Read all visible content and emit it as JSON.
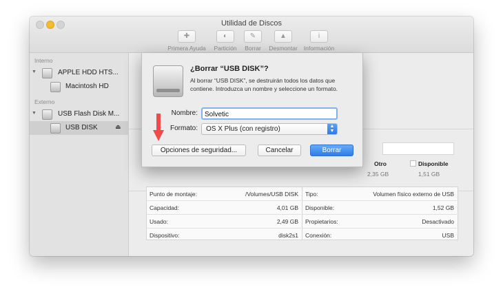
{
  "window": {
    "title": "Utilidad de Discos",
    "toolbar": [
      {
        "label": "Primera Ayuda",
        "icon": "first-aid-icon"
      },
      {
        "label": "Partición",
        "icon": "partition-icon"
      },
      {
        "label": "Borrar",
        "icon": "erase-icon"
      },
      {
        "label": "Desmontar",
        "icon": "unmount-icon"
      },
      {
        "label": "Información",
        "icon": "info-icon"
      }
    ]
  },
  "sidebar": {
    "internal_header": "Interno",
    "external_header": "Externo",
    "items": [
      {
        "label": "APPLE HDD HTS..."
      },
      {
        "label": "Macintosh HD"
      },
      {
        "label": "USB Flash Disk M..."
      },
      {
        "label": "USB DISK",
        "eject": "⏏"
      }
    ]
  },
  "usage": {
    "other_label": "Otro",
    "other_value": "2,35 GB",
    "other_color": "#ffffff",
    "available_label": "Disponible",
    "available_value": "1,51 GB",
    "available_color": "#ffffff"
  },
  "info": {
    "left": [
      {
        "key": "Punto de montaje:",
        "value": "/Volumes/USB DISK"
      },
      {
        "key": "Capacidad:",
        "value": "4,01 GB"
      },
      {
        "key": "Usado:",
        "value": "2,49 GB"
      },
      {
        "key": "Dispositivo:",
        "value": "disk2s1"
      }
    ],
    "right": [
      {
        "key": "Tipo:",
        "value": "Volumen físico externo de USB"
      },
      {
        "key": "Disponible:",
        "value": "1,52 GB"
      },
      {
        "key": "Propietarios:",
        "value": "Desactivado"
      },
      {
        "key": "Conexión:",
        "value": "USB"
      }
    ]
  },
  "dialog": {
    "title": "¿Borrar “USB DISK”?",
    "message": "Al borrar “USB DISK”, se destruirán todos los datos que contiene. Introduzca un nombre y seleccione un formato.",
    "name_label": "Nombre:",
    "name_value": "Solvetic",
    "format_label": "Formato:",
    "format_value": "OS X Plus (con registro)",
    "security_button": "Opciones de seguridad...",
    "cancel_button": "Cancelar",
    "erase_button": "Borrar",
    "accent_color": "#2e7ce6",
    "arrow_color": "#f04a4a"
  }
}
